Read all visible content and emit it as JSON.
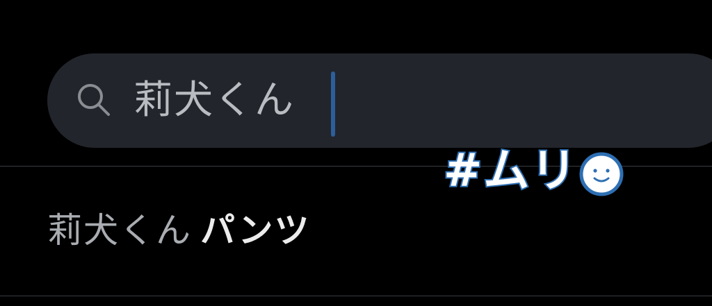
{
  "search": {
    "query": "莉犬くん",
    "icon": "search-icon"
  },
  "suggestions": [
    {
      "query_part": "莉犬くん",
      "completion": "パンツ"
    }
  ],
  "sticker": {
    "text": "#ムリ",
    "icon": "smiley-icon"
  },
  "colors": {
    "background": "#000000",
    "search_bar": "#22252b",
    "caret": "#2c5f9a",
    "sticker_outline": "#2e6fb3"
  }
}
